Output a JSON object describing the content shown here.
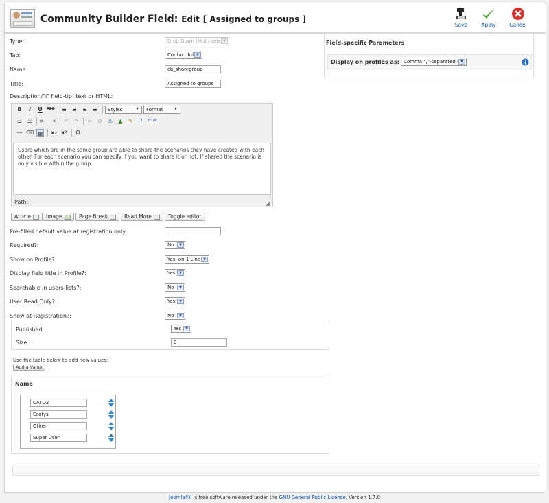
{
  "header": {
    "title_prefix": "Community Builder Field:",
    "title_edit": "Edit",
    "title_item": "[ Assigned to groups ]",
    "toolbar": {
      "save": "Save",
      "apply": "Apply",
      "cancel": "Cancel"
    }
  },
  "form": {
    "type_label": "Type:",
    "type_value": "Drop Down (Multi-select)",
    "tab_label": "Tab:",
    "tab_value": "Contact Info",
    "name_label": "Name:",
    "name_value": "cb_sharegroup",
    "title_label": "Title:",
    "title_value": "Assigned to groups",
    "desc_label": "Description/\"i\" field-tip: text or HTML:",
    "prefill_label": "Pre-filled default value at registration only:",
    "required_label": "Required?:",
    "required_value": "No",
    "show_profile_label": "Show on Profile?:",
    "show_profile_value": "Yes: on 1 Line",
    "display_title_label": "Display field title in Profile?:",
    "display_title_value": "Yes",
    "searchable_label": "Searchable in users-lists?:",
    "searchable_value": "No",
    "readonly_label": "User Read Only?:",
    "readonly_value": "Yes",
    "show_reg_label": "Show at Registration?:",
    "show_reg_value": "No",
    "published_label": "Published:",
    "published_value": "Yes",
    "size_label": "Size:",
    "size_value": "0"
  },
  "editor": {
    "styles": "Styles",
    "format": "Format",
    "html_label": "HTML",
    "content": "Users which are in the same group are able to share the scenarios they have created with each other. For each scenario you can specify if you want to share it or not. If shared the scenario is only visible within the group.",
    "path_label": "Path:",
    "buttons": {
      "article": "Article",
      "image": "Image",
      "page_break": "Page Break",
      "read_more": "Read More",
      "toggle": "Toggle editor"
    }
  },
  "params": {
    "heading": "Field-specific Parameters",
    "display_label": "Display on profiles as:",
    "display_value": "Comma \",\"-separated line"
  },
  "values": {
    "hint": "Use the table below to add new values:",
    "add_button": "Add a Value",
    "name_header": "Name",
    "items": [
      "CATO2",
      "Ecofys",
      "Other",
      "Super User"
    ]
  },
  "footer": {
    "joomla": "Joomla!®",
    "middle": " is free software released under the ",
    "license": "GNU General Public License",
    "version": ". Version 1.7.0"
  }
}
